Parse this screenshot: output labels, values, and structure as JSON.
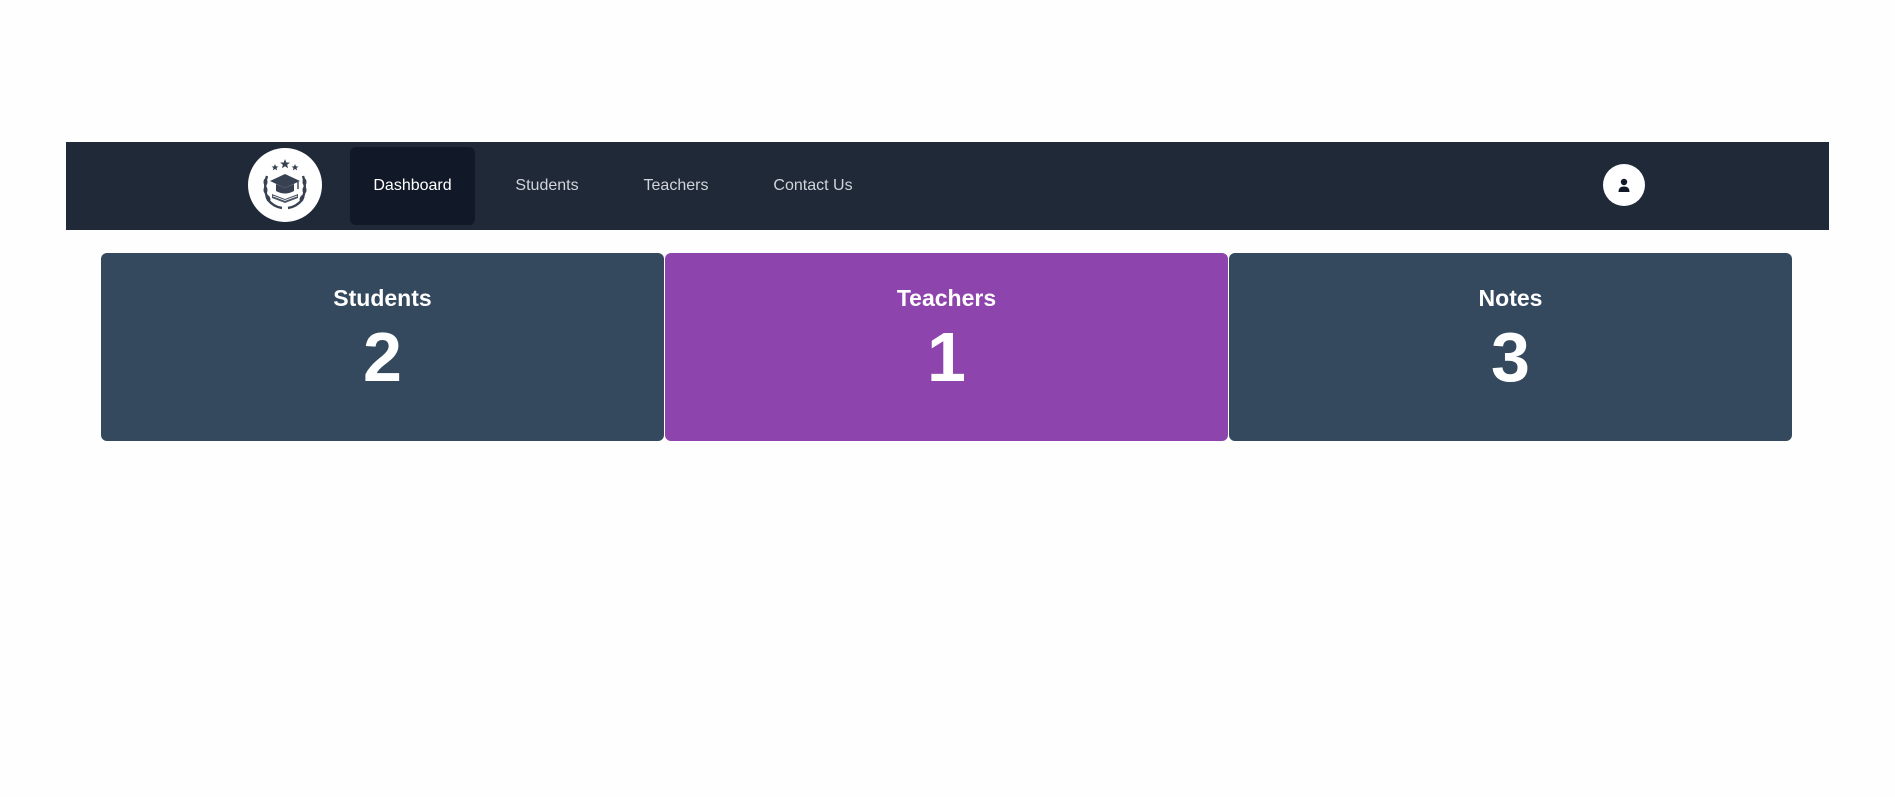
{
  "nav": {
    "logo_icon": "graduation-cap-laurel-icon",
    "items": [
      {
        "label": "Dashboard",
        "active": true
      },
      {
        "label": "Students",
        "active": false
      },
      {
        "label": "Teachers",
        "active": false
      },
      {
        "label": "Contact Us",
        "active": false
      }
    ],
    "user_icon": "user-icon"
  },
  "stats": [
    {
      "title": "Students",
      "value": "2",
      "color": "#34495e"
    },
    {
      "title": "Teachers",
      "value": "1",
      "color": "#8e44ad"
    },
    {
      "title": "Notes",
      "value": "3",
      "color": "#34495e"
    }
  ],
  "colors": {
    "navbar": "#1f2937",
    "nav_active": "#111827"
  }
}
